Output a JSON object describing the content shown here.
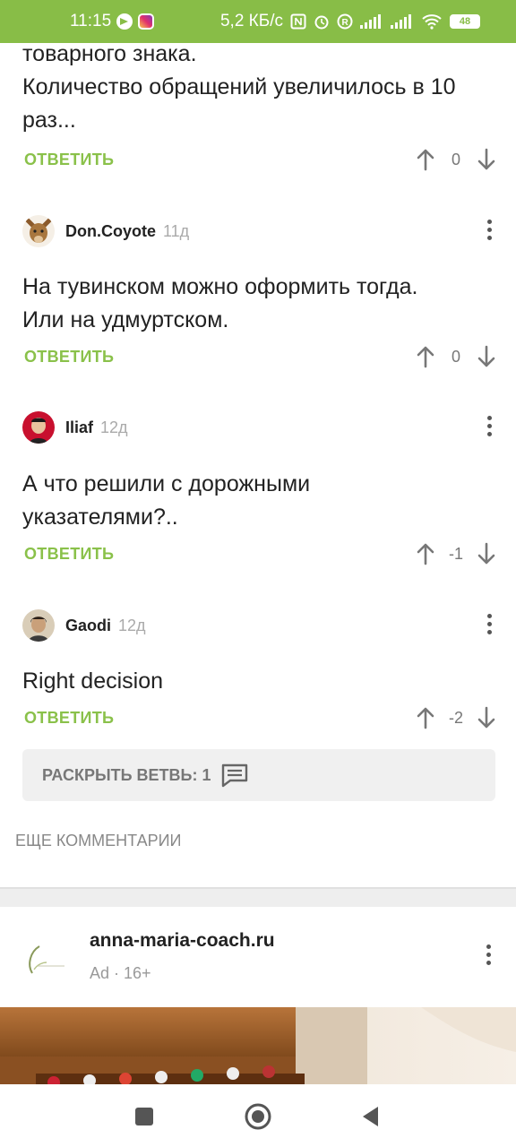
{
  "status_bar": {
    "time": "11:15",
    "network_speed": "5,2 КБ/с",
    "battery": "48",
    "icons": [
      "telegram-icon",
      "instagram-icon",
      "nfc-icon",
      "alarm-icon",
      "roaming-icon",
      "signal-icon",
      "signal-icon",
      "wifi-icon",
      "battery-icon"
    ]
  },
  "comments": [
    {
      "text_lines": [
        "товарного знака.",
        "Количество обращений увеличилось в 10",
        "раз..."
      ],
      "reply_label": "ОТВЕТИТЬ",
      "score": "0"
    },
    {
      "author": "Don.Coyote",
      "age": "11д",
      "text_lines": [
        "На тувинском можно оформить тогда.",
        "Или на удмуртском."
      ],
      "reply_label": "ОТВЕТИТЬ",
      "score": "0"
    },
    {
      "author": "Iliaf",
      "age": "12д",
      "text_lines": [
        "А что решили с дорожными",
        "указателями?.."
      ],
      "reply_label": "ОТВЕТИТЬ",
      "score": "-1"
    },
    {
      "author": "Gaodi",
      "age": "12д",
      "text_lines": [
        "Right decision"
      ],
      "reply_label": "ОТВЕТИТЬ",
      "score": "-2"
    }
  ],
  "expand_branch": {
    "label": "РАСКРЫТЬ ВЕТВЬ: 1"
  },
  "more_comments": {
    "label": "ЕЩЕ КОММЕНТАРИИ"
  },
  "ad": {
    "domain": "anna-maria-coach.ru",
    "meta": "Ad · 16+"
  },
  "colors": {
    "accent": "#88bd47",
    "reply_green": "#8ac14a"
  }
}
